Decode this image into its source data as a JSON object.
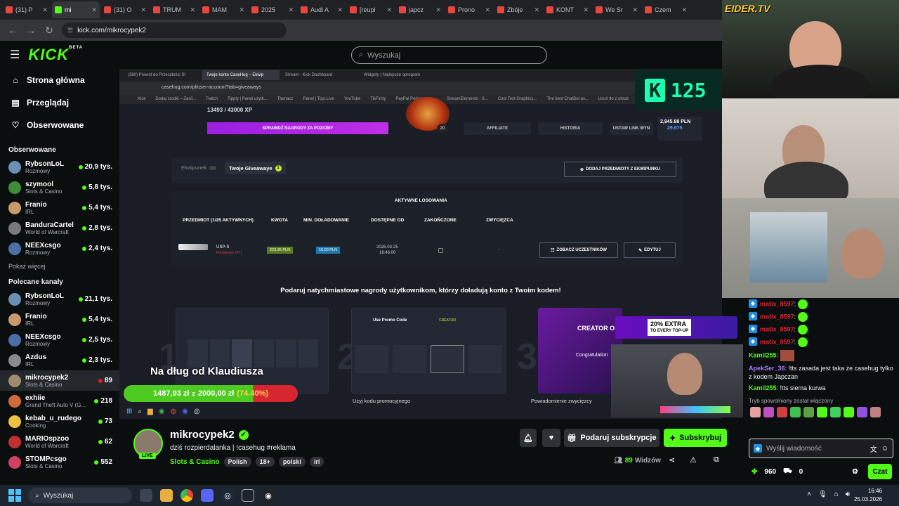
{
  "browser": {
    "tabs": [
      {
        "label": "(31) P",
        "active": false
      },
      {
        "label": "mi",
        "active": true
      },
      {
        "label": "(31) O",
        "active": false
      },
      {
        "label": "TRUM",
        "active": false
      },
      {
        "label": "MAM",
        "active": false
      },
      {
        "label": "2025",
        "active": false
      },
      {
        "label": "Audi A",
        "active": false
      },
      {
        "label": "[reupl",
        "active": false
      },
      {
        "label": "japcz",
        "active": false
      },
      {
        "label": "Prono",
        "active": false
      },
      {
        "label": "Zbóje",
        "active": false
      },
      {
        "label": "KONT",
        "active": false
      },
      {
        "label": "We Sr",
        "active": false
      },
      {
        "label": "Czem",
        "active": false
      }
    ],
    "url": "kick.com/mikrocypek2"
  },
  "header": {
    "logo": "KICK",
    "logo_badge": "BETA",
    "search_placeholder": "Wyszukaj"
  },
  "sidebar": {
    "nav": [
      {
        "label": "Strona główna",
        "icon": "home-icon"
      },
      {
        "label": "Przeglądaj",
        "icon": "browse-icon"
      },
      {
        "label": "Obserwowane",
        "icon": "heart-icon"
      }
    ],
    "followed_title": "Obserwowane",
    "followed": [
      {
        "name": "RybsonLoL",
        "category": "Rozmowy",
        "viewers": "20,9 tys.",
        "color": "#6b8fb5"
      },
      {
        "name": "szymool",
        "category": "Slots & Casino",
        "viewers": "5,8 tys.",
        "color": "#3e8d3a"
      },
      {
        "name": "Franio",
        "category": "IRL",
        "viewers": "5,4 tys.",
        "color": "#c99a6b"
      },
      {
        "name": "BanduraCartel",
        "category": "World of Warcraft",
        "viewers": "2,8 tys.",
        "color": "#7a7a7a"
      },
      {
        "name": "NEEXcsgo",
        "category": "Rozmowy",
        "viewers": "2,4 tys.",
        "color": "#4d6fa8"
      }
    ],
    "show_more": "Pokaż więcej",
    "recommended_title": "Polecane kanały",
    "recommended": [
      {
        "name": "RybsonLoL",
        "category": "Rozmowy",
        "viewers": "21,1 tys.",
        "color": "#6b8fb5",
        "active": false
      },
      {
        "name": "Franio",
        "category": "IRL",
        "viewers": "5,4 tys.",
        "color": "#c99a6b",
        "active": false
      },
      {
        "name": "NEEXcsgo",
        "category": "Rozmowy",
        "viewers": "2,5 tys.",
        "color": "#4d6fa8",
        "active": false
      },
      {
        "name": "Azdus",
        "category": "IRL",
        "viewers": "2,3 tys.",
        "color": "#8a8a8a",
        "active": false
      },
      {
        "name": "mikrocypek2",
        "category": "Slots & Casino",
        "viewers": "89",
        "color": "#a08a70",
        "active": true
      },
      {
        "name": "exhiie",
        "category": "Grand Theft Auto V (G...",
        "viewers": "218",
        "color": "#d06a3a",
        "active": false
      },
      {
        "name": "kebab_u_rudego",
        "category": "Cooking",
        "viewers": "73",
        "color": "#f0c040",
        "active": false
      },
      {
        "name": "MARIOspzoo",
        "category": "World of Warcraft",
        "viewers": "62",
        "color": "#c03030",
        "active": false
      },
      {
        "name": "STOMPcsgo",
        "category": "Slots & Casino",
        "viewers": "552",
        "color": "#d04060",
        "active": false
      }
    ]
  },
  "video": {
    "inner_tabs": [
      "(380) Powrót do Przeszłości St",
      "Twoje konto CaseHug – Ekwip",
      "Stream - Kick Dashboard",
      "Widgety | Najlepsze oprogram"
    ],
    "inner_url": "casehug.com/pl/user-account?tab=giveaways",
    "bookmarks": [
      "Kick",
      "Dodaj środki – Zasil...",
      "Twitch",
      "Tipply | Panel użytk...",
      "Tłumacz",
      "Panel | Tipo.Live",
      "YouTube",
      "TikFinity",
      "PayPal Podsumowa...",
      "StreamElements - S...",
      "Cool Text Graphics...",
      "The best ChatBot av...",
      "Usuń tło z obraz"
    ],
    "xp": "13493 / 43000 XP",
    "rewards_button": "SPRAWDŹ NAGRODY ZA POZIOMY",
    "level": "20",
    "affiliate": "AFFILIATE",
    "history": "HISTORIA",
    "set_link": "USTAW LINK WYN",
    "balance": "2,945.88 PLN",
    "coins": "29,675",
    "tab_equipment": "Ekwipunek",
    "tab_giveaways": "Twoje Giveawaye",
    "giveaways_count": "1",
    "add_items": "DODAJ PRZEDMIOTY Z EKWIPUNKU",
    "active_title": "AKTYWNE LOSOWANIA",
    "columns": [
      "PRZEDMIOT (1/25 AKTYWNYCH)",
      "KWOTA",
      "MIN. DOŁADOWANIE",
      "DOSTĘPNE OD",
      "ZAKOŃCZONE",
      "ZWYCIĘZCA"
    ],
    "row": {
      "item": "USP-S",
      "item_sub": "Printstream (FT)",
      "amount": "223.36 PLN",
      "min": "10.00 PLN",
      "date": "2026-03-25",
      "time": "16:46:00",
      "winner": "-",
      "btn_participants": "ZOBACZ UCZESTNIKÓW",
      "btn_edit": "EDYTUJ"
    },
    "promo_heading": "Podaruj natychmiastowe nagrody użytkownikom, którzy doładują konto z Twoim kodem!",
    "step_captions": [
      "Użyj kodu promocyjnego",
      "Powiadomienie zwycięzcy"
    ],
    "card2_title": "Use Promo Code",
    "card2_sub": "CREATOR",
    "card3_title": "CREATOR O",
    "card3_sub": "Congratulation",
    "extra_banner": "20% EXTRA",
    "extra_sub": "TO EVERY TOP-UP",
    "kick_sign": "125",
    "debt_title": "Na dług od Klaudiusza",
    "debt_current": "1487,93 zł",
    "debt_of": "z",
    "debt_target": "2000,00 zł",
    "debt_pct": "(74.40%)",
    "debt_fraction": 0.744
  },
  "cam_overlay": "EIDER.TV",
  "channel": {
    "name": "mikrocypek2",
    "live": "LIVE",
    "title": "dziś rozpierdalanka | !casehug #reklama",
    "category": "Slots & Casino",
    "tags": [
      "Polish",
      "18+",
      "polski",
      "irl"
    ],
    "gift_sub": "Podaruj subskrypcje",
    "subscribe": "Subskrybuj",
    "viewers": "89",
    "viewers_label": "Widzów"
  },
  "chat": {
    "messages": [
      {
        "user": "matix_8597",
        "text": ":",
        "color": "#e0242f",
        "emote": true
      },
      {
        "user": "matix_8597",
        "text": ":",
        "color": "#e0242f",
        "emote": true
      },
      {
        "user": "matix_8597",
        "text": ":",
        "color": "#e0242f",
        "emote": true
      },
      {
        "user": "matix_8597",
        "text": ":",
        "color": "#e0242f",
        "emote": true
      },
      {
        "user": "Kamil255",
        "text": ":",
        "color": "#53fc18",
        "emote": "box"
      },
      {
        "user": "ApekSer_36",
        "text": ": !tts zasada jest taka że casehug tylko z kodem Japczan",
        "color": "#a77cff",
        "emote": false
      },
      {
        "user": "Kamil255",
        "text": ": !tts siema kurwa",
        "color": "#53fc18",
        "emote": false
      }
    ],
    "slow_mode": "Tryb spowolniony został włączony",
    "input_placeholder": "Wyślij wiadomość",
    "points": "960",
    "items": "0",
    "send_label": "Czat"
  },
  "os": {
    "search": "Wyszukaj",
    "time": "16:46",
    "date": "25.03.2026"
  }
}
